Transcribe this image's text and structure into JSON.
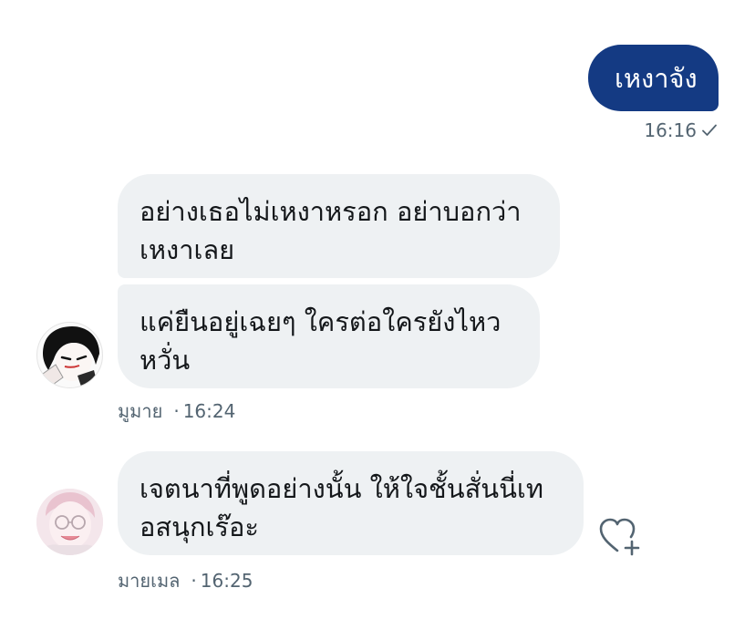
{
  "conversation": {
    "sent_message": {
      "text": "เหงาจัง",
      "time": "16:16"
    },
    "received": [
      {
        "sender": "มูมาย",
        "time": "16:24",
        "messages": [
          {
            "lines": [
              "อย่างเธอไม่เหงาหรอก อย่าบอกว่า",
              "เหงาเลย"
            ]
          },
          {
            "lines": [
              "แค่ยืนอยู่เฉยๆ ใครต่อใครยังไหว",
              "หวั่น"
            ]
          }
        ],
        "avatar_icon": "anime-girl-avatar"
      },
      {
        "sender": "มายเมล",
        "time": "16:25",
        "messages": [
          {
            "lines": [
              "เจตนาที่พูดอย่างนั้น ให้ใจชั้นสั่นนี่เท",
              "อสนุกเร๊อะ"
            ]
          }
        ],
        "avatar_icon": "smiling-person-avatar"
      }
    ],
    "dot_separator": "·",
    "react_icon": "heart-plus-icon"
  },
  "colors": {
    "sent_bubble": "#143a83",
    "received_bubble": "#eef1f3",
    "meta_text": "#536471"
  }
}
